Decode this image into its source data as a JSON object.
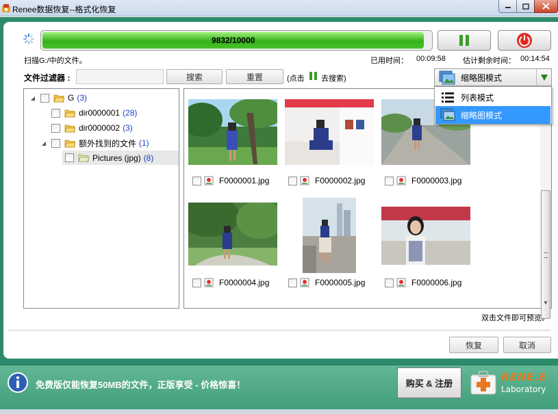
{
  "window": {
    "title": "Renee数据恢复--格式化恢复"
  },
  "progress": {
    "text": "9832/10000",
    "value": 9832,
    "max": 10000
  },
  "scan": {
    "status": "扫描G:/中的文件。",
    "used_label": "已用时间：",
    "used_value": "00:09:58",
    "remain_label": "估计剩余时间：",
    "remain_value": "00:14:54"
  },
  "filter": {
    "label": "文件过滤器 :",
    "value": "",
    "search": "搜索",
    "reset": "重置",
    "hint_pre": "(点击",
    "hint_post": "去搜索)"
  },
  "view": {
    "selected": "缩略图模式",
    "options": [
      "列表模式",
      "缩略图模式"
    ]
  },
  "tree": [
    {
      "label": "G",
      "count": "(3)"
    },
    {
      "label": "dir0000001",
      "count": "(28)"
    },
    {
      "label": "dir0000002",
      "count": "(3)"
    },
    {
      "label": "额外找到的文件",
      "count": "(1)"
    },
    {
      "label": "Pictures (jpg)",
      "count": "(8)"
    }
  ],
  "files": [
    {
      "name": "F0000001.jpg"
    },
    {
      "name": "F0000002.jpg"
    },
    {
      "name": "F0000003.jpg"
    },
    {
      "name": "F0000004.jpg"
    },
    {
      "name": "F0000005.jpg"
    },
    {
      "name": "F0000006.jpg"
    }
  ],
  "preview_hint": "双击文件即可预览。",
  "actions": {
    "recover": "恢复",
    "cancel": "取消"
  },
  "footer": {
    "notice": "免费版仅能恢复50MB的文件，正版享受 - 价格惊喜！",
    "buy": "购买 & 注册",
    "brand": "RENE.E",
    "brand_sub": "Laboratory"
  },
  "colors": {
    "frame": "#2d8a6a",
    "progress": "#35b21b",
    "selection": "#3399ff",
    "count": "#1a3fbf"
  }
}
